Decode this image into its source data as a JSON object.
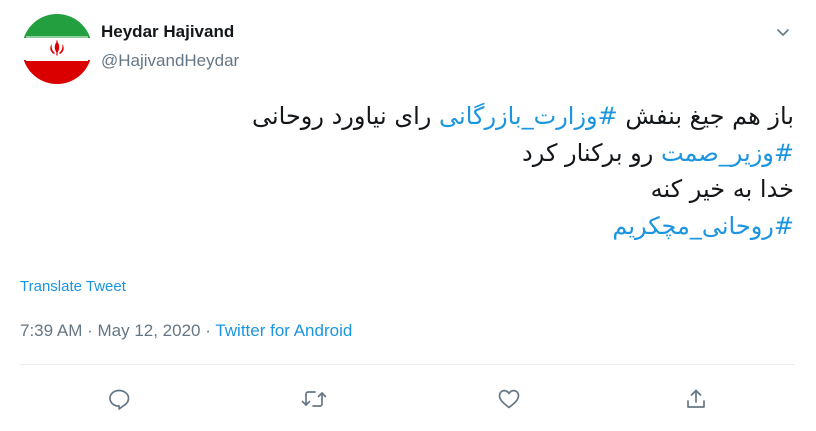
{
  "user": {
    "name": "Heydar Hajivand",
    "handle": "@HajivandHeydar",
    "avatar_icon": "iran-flag-icon"
  },
  "tweet": {
    "line1": {
      "before": "باز هم جیغ بنفش ",
      "tag": "#وزارت_بازرگانی",
      "after": " رای نیاورد روحانی"
    },
    "line2": {
      "tag": "#وزیر_صمت",
      "after": " رو برکنار کرد"
    },
    "line3": "خدا به خیر کنه",
    "line4": {
      "tag": "#روحانی_مچکریم"
    }
  },
  "translate_label": "Translate Tweet",
  "meta": {
    "time": "7:39 AM",
    "separator": " · ",
    "date": "May 12, 2020",
    "source": "Twitter for Android"
  },
  "actions": [
    "reply-icon",
    "retweet-icon",
    "like-icon",
    "share-icon"
  ],
  "colors": {
    "link": "#1b95e0",
    "secondary": "#657786",
    "text": "#14171a"
  }
}
